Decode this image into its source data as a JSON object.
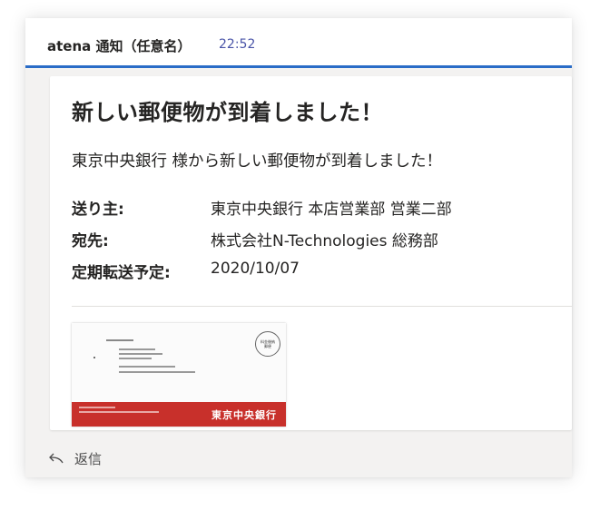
{
  "header": {
    "sender": "atena 通知（任意名）",
    "time": "22:52"
  },
  "card": {
    "title": "新しい郵便物が到着しました！",
    "subtitle": "東京中央銀行 様から新しい郵便物が到着しました！",
    "facts": [
      {
        "label": "送り主:",
        "value": "東京中央銀行 本店営業部 営業二部"
      },
      {
        "label": "宛先:",
        "value": "株式会社N-Technologies 総務部"
      },
      {
        "label": "定期転送予定:",
        "value": "2020/10/07"
      }
    ],
    "envelope": {
      "brand": "東京中央銀行",
      "stamp_text": "料金後納郵便"
    }
  },
  "footer": {
    "reply_label": "返信",
    "reply_icon": "reply-arrow-icon"
  },
  "colors": {
    "accent": "#2a6cc7",
    "time": "#4a55a8",
    "envelope_band": "#c8302b"
  }
}
